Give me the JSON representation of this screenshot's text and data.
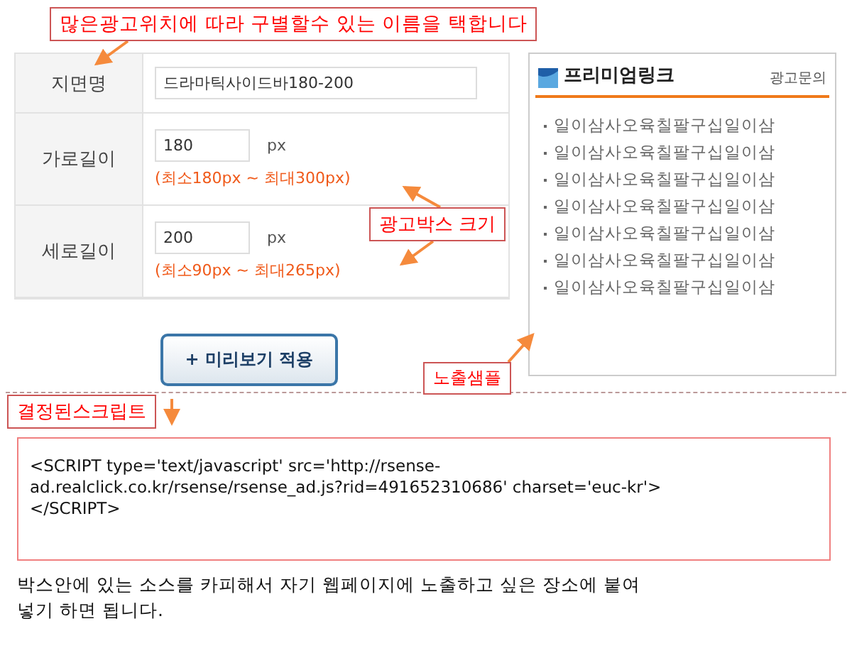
{
  "annotations": [
    {
      "text": "많은광고위치에 따라 구별할수 있는 이름을 택합니다"
    },
    {
      "text": "광고박스 크기"
    },
    {
      "text": "노출샘플"
    },
    {
      "text": "결정된스크립트"
    }
  ],
  "form": {
    "rows": [
      {
        "kind": "name",
        "label": "지면명",
        "value": "드라마틱사이드바180-200"
      },
      {
        "kind": "size",
        "label": "가로길이",
        "value": "180",
        "unit": "px",
        "range": "(최소180px ~ 최대300px)"
      },
      {
        "kind": "size",
        "label": "세로길이",
        "value": "200",
        "unit": "px",
        "range": "(최소90px ~ 최대265px)"
      }
    ]
  },
  "preview_button": "+ 미리보기 적용",
  "preview": {
    "title": "프리미엄링크",
    "link": "광고문의",
    "items": [
      "일이삼사오육칠팔구십일이삼",
      "일이삼사오육칠팔구십일이삼",
      "일이삼사오육칠팔구십일이삼",
      "일이삼사오육칠팔구십일이삼",
      "일이삼사오육칠팔구십일이삼",
      "일이삼사오육칠팔구십일이삼",
      "일이삼사오육칠팔구십일이삼"
    ]
  },
  "script": "<SCRIPT type='text/javascript' src='http://rsense-\nad.realclick.co.kr/rsense/rsense_ad.js?rid=491652310686' charset='euc-kr'>\n</SCRIPT>",
  "instructions": "박스안에 있는 소스를 카피해서 자기 웹페이지에 노출하고 싶은 장소에 붙여 넣기 하면 됩니다."
}
